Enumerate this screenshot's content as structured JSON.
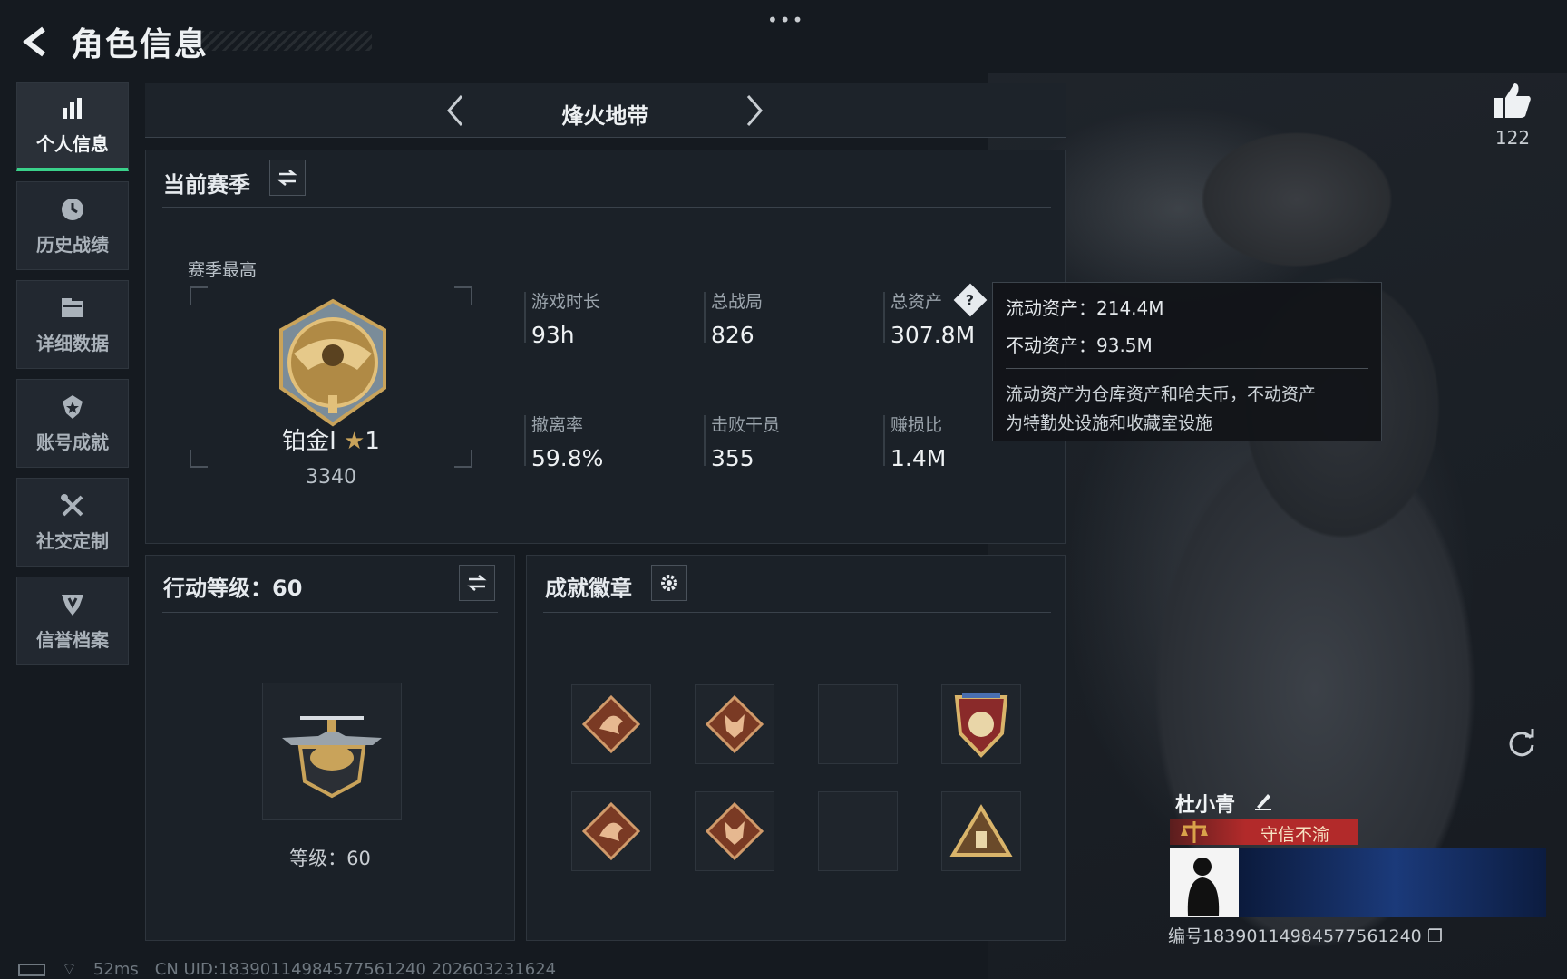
{
  "header": {
    "title": "角色信息"
  },
  "sidebar": {
    "items": [
      {
        "label": "个人信息",
        "icon": "bar-chart-icon",
        "active": true
      },
      {
        "label": "历史战绩",
        "icon": "history-icon",
        "active": false
      },
      {
        "label": "详细数据",
        "icon": "folder-icon",
        "active": false
      },
      {
        "label": "账号成就",
        "icon": "achievement-icon",
        "active": false
      },
      {
        "label": "社交定制",
        "icon": "tools-icon",
        "active": false
      },
      {
        "label": "信誉档案",
        "icon": "shield-icon",
        "active": false
      }
    ]
  },
  "map_selector": {
    "name": "烽火地带"
  },
  "season": {
    "title": "当前赛季",
    "highest_label": "赛季最高",
    "rank_name": "铂金I",
    "rank_stars": "1",
    "rank_score": "3340",
    "stats": [
      {
        "label": "游戏时长",
        "value": "93h"
      },
      {
        "label": "总战局",
        "value": "826"
      },
      {
        "label": "总资产",
        "value": "307.8M"
      },
      {
        "label": "撤离率",
        "value": "59.8%"
      },
      {
        "label": "击败干员",
        "value": "355"
      },
      {
        "label": "赚损比",
        "value": "1.4M"
      }
    ]
  },
  "tooltip": {
    "liquid": "流动资产：214.4M",
    "fixed": "不动资产：93.5M",
    "desc_line1": "流动资产为仓库资产和哈夫币，不动资产",
    "desc_line2": "为特勤处设施和收藏室设施"
  },
  "level": {
    "title": "行动等级：60",
    "label": "等级：60"
  },
  "badges": {
    "title": "成就徽章"
  },
  "likes": {
    "count": "122"
  },
  "player": {
    "name": "杜小青",
    "title": "守信不渝",
    "id": "编号183901149845775612​40"
  },
  "status": {
    "ping": "52ms",
    "uid": "CN UID:1839011498457756​1240 202603231624"
  },
  "colors": {
    "accent": "#3ad18a",
    "title_red": "#b22a2a",
    "gold": "#c9a35a"
  }
}
